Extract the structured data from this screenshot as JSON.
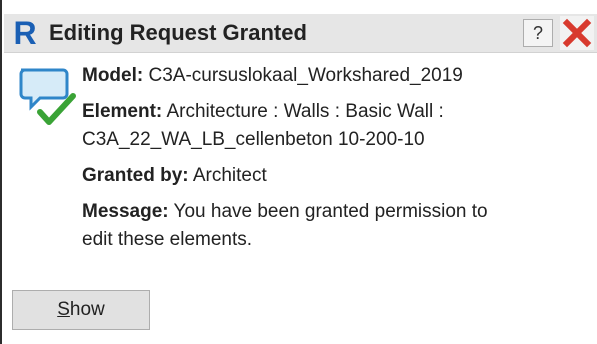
{
  "window": {
    "title": "Editing Request Granted",
    "logo_letter": "R",
    "help_label": "?"
  },
  "details": {
    "model_label": "Model:",
    "model_value": "C3A-cursuslokaal_Workshared_2019",
    "element_label": "Element:",
    "element_value_line1": "Architecture : Walls : Basic Wall :",
    "element_value_line2": "C3A_22_WA_LB_cellenbeton 10-200-10",
    "granted_label": "Granted by:",
    "granted_value": "Architect",
    "message_label": "Message:",
    "message_value_line1": "You have been granted permission to",
    "message_value_line2": "edit these elements."
  },
  "buttons": {
    "show_access_key": "S",
    "show_rest": "how"
  },
  "icons": {
    "logo": "revit-logo-icon",
    "help": "help-icon",
    "close": "close-icon",
    "notification": "speech-bubble-checkmark-icon"
  },
  "colors": {
    "logo_blue": "#1a5fb4",
    "close_red": "#d83a2e",
    "check_green": "#3aa336",
    "bubble_blue": "#2f86c9"
  }
}
